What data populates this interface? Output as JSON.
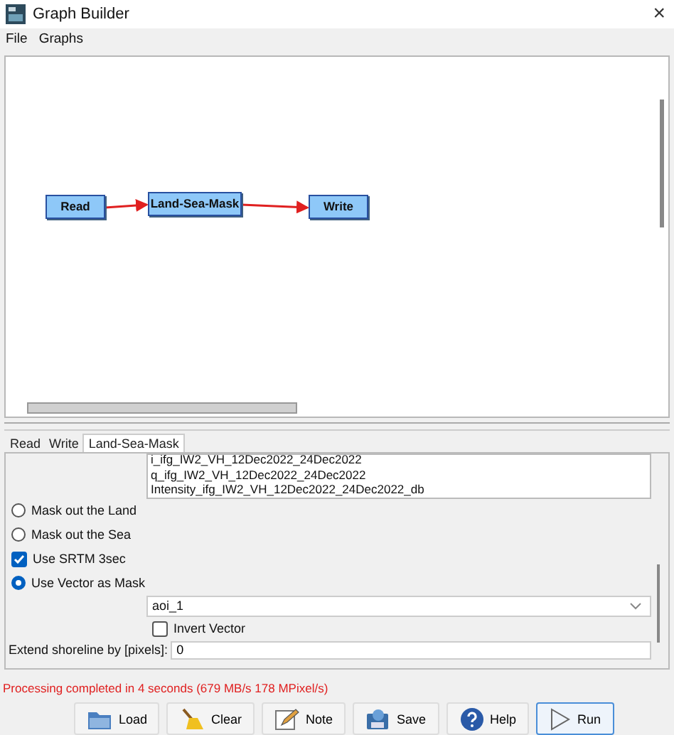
{
  "window": {
    "title": "Graph Builder",
    "close": "×"
  },
  "menu": [
    {
      "label": "File"
    },
    {
      "label": "Graphs"
    }
  ],
  "graph": {
    "nodes": [
      {
        "label": "Read"
      },
      {
        "label": "Land-Sea-Mask"
      },
      {
        "label": "Write"
      }
    ]
  },
  "tabs": [
    {
      "label": "Read",
      "selected": false
    },
    {
      "label": "Write",
      "selected": false
    },
    {
      "label": "Land-Sea-Mask",
      "selected": true
    }
  ],
  "bands": [
    "i_ifg_IW2_VH_12Dec2022_24Dec2022",
    "q_ifg_IW2_VH_12Dec2022_24Dec2022",
    "Intensity_ifg_IW2_VH_12Dec2022_24Dec2022_db"
  ],
  "options": [
    {
      "kind": "radio",
      "label": "Mask out the Land",
      "selected": false
    },
    {
      "kind": "radio",
      "label": "Mask out the Sea",
      "selected": false
    },
    {
      "kind": "checkbox",
      "label": "Use SRTM 3sec",
      "checked": true
    },
    {
      "kind": "radio",
      "label": "Use Vector as Mask",
      "selected": true
    }
  ],
  "vector": {
    "value": "aoi_1"
  },
  "invert": {
    "label": "Invert Vector",
    "checked": false
  },
  "shoreline": {
    "label": "Extend shoreline by [pixels]:",
    "value": "0"
  },
  "status": "Processing completed in 4 seconds (679 MB/s 178 MPixel/s)",
  "buttons": [
    {
      "kind": "load",
      "label": "Load"
    },
    {
      "kind": "clear",
      "label": "Clear"
    },
    {
      "kind": "note",
      "label": "Note"
    },
    {
      "kind": "save",
      "label": "Save"
    },
    {
      "kind": "help",
      "label": "Help"
    },
    {
      "kind": "run",
      "label": "Run"
    }
  ]
}
